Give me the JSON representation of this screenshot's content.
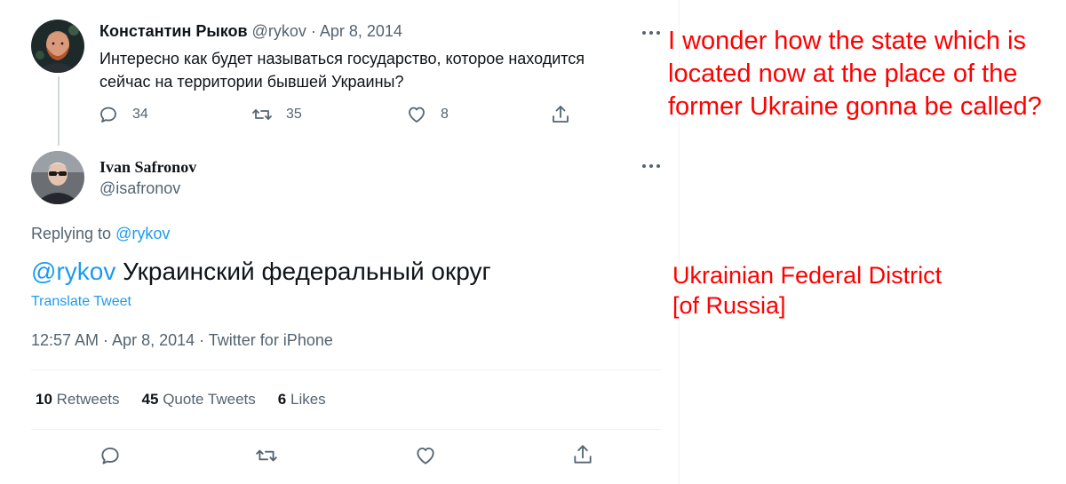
{
  "parent_tweet": {
    "author_name": "Константин Рыков",
    "author_handle": "@rykov",
    "separator": " · ",
    "date": "Apr 8, 2014",
    "text": "Интересно как будет называться государство, которое находится сейчас на территории бывшей Украины?",
    "actions": {
      "reply_count": "34",
      "retweet_count": "35",
      "like_count": "8"
    }
  },
  "main_tweet": {
    "author_name": "Ivan Safronov",
    "author_handle": "@isafronov",
    "replying_to_label": "Replying to ",
    "replying_to_handle": "@rykov",
    "mention": "@rykov",
    "text": " Украинский федеральный округ",
    "translate_label": "Translate Tweet",
    "meta": "12:57 AM · Apr 8, 2014 · Twitter for iPhone",
    "stats": {
      "retweets_count": "10",
      "retweets_label": "Retweets",
      "quote_tweets_count": "45",
      "quote_tweets_label": "Quote Tweets",
      "likes_count": "6",
      "likes_label": "Likes"
    }
  },
  "annotations": {
    "translation_parent": "I wonder how the state which is located now at the place of the former Ukraine gonna be called?",
    "translation_reply_line1": "Ukrainian Federal District",
    "translation_reply_line2": "[of Russia]"
  },
  "colors": {
    "text_primary": "#0f1419",
    "text_secondary": "#536471",
    "link": "#1d9bf0",
    "divider": "#eff3f4",
    "thread_line": "#cfd9de",
    "annotation": "#ff0000"
  },
  "icons": {
    "reply": "reply-icon",
    "retweet": "retweet-icon",
    "like": "heart-icon",
    "share": "share-icon",
    "more": "more-icon"
  }
}
